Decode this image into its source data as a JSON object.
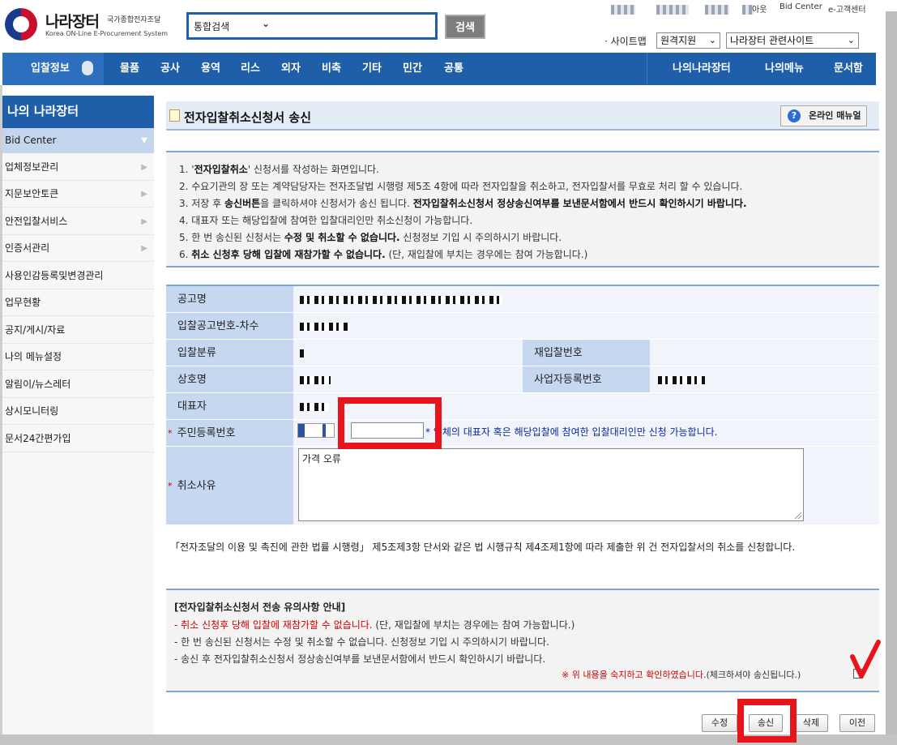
{
  "header": {
    "logo_title": "나라장터",
    "logo_sub_kr": "국가종합전자조달",
    "logo_sub_en": "Korea ON-Line E-Procurement System",
    "search_category": "통합검색",
    "search_button": "검색",
    "util_links": [
      "아웃",
      "Bid Center",
      "e-고객센터"
    ],
    "sitemap_label": "· 사이트맵",
    "remote_support": "원격지원",
    "related_sites": "나라장터 관련사이트"
  },
  "nav": {
    "first": "입찰정보",
    "items": [
      "물품",
      "공사",
      "용역",
      "리스",
      "외자",
      "비축",
      "기타",
      "민간",
      "공통"
    ],
    "right_items": [
      "나의나라장터",
      "나의메뉴",
      "문서함"
    ]
  },
  "sidebar": {
    "title": "나의 나라장터",
    "selected": "Bid Center",
    "items": [
      "업체정보관리",
      "지문보안토큰",
      "안전입찰서비스",
      "인증서관리",
      "사용인감등록및변경관리",
      "업무현황",
      "공지/게시/자료",
      "나의 메뉴설정",
      "알림이/뉴스레터",
      "상시모니터링",
      "문서24간편가입"
    ]
  },
  "page": {
    "title": "전자입찰취소신청서 송신",
    "manual_button": "온라인 매뉴얼",
    "notices": {
      "n1_pre": "1. '",
      "n1_bold": "전자입찰취소",
      "n1_post": "' 신청서를 작성하는 화면입니다.",
      "n2": "2. 수요기관의 장 또는 계약담당자는 전자조달법 시행령 제5조 4항에 따라 전자입찰을 취소하고, 전자입찰서를 무효로 처리 할 수 있습니다.",
      "n3_pre": "3. 저장 후 ",
      "n3_bold1": "송신버튼",
      "n3_mid": "을 클릭하셔야 신청서가 송신 됩니다. ",
      "n3_bold2": "전자입찰취소신청서 정상송신여부를 보낸문서함에서 반드시 확인하시기 바랍니다.",
      "n4": "4. 대표자 또는 해당입찰에 참여한 입찰대리인만 취소신청이 가능합니다.",
      "n5_pre": "5. 한 번 송신된 신청서는 ",
      "n5_bold": "수정 및 취소할 수 없습니다.",
      "n5_post": " 신청정보 기입 시 주의하시기 바랍니다.",
      "n6_pre": "6. ",
      "n6_bold": "취소 신청후 당해 입찰에 재참가할 수 없습니다.",
      "n6_post": " (단, 재입찰에 부치는 경우에는 참여 가능합니다.)"
    },
    "form": {
      "notice_name_label": "공고명",
      "bid_no_label": "입찰공고번호-차수",
      "bid_class_label": "입찰분류",
      "rebid_no_label": "재입찰번호",
      "company_label": "상호명",
      "biz_reg_label": "사업자등록번호",
      "ceo_label": "대표자",
      "rrn_label": "주민등록번호",
      "rrn_dash": "-",
      "rrn_note": "* 업체의 대표자 혹은 해당입찰에 참여한 입찰대리인만 신청 가능합니다.",
      "reason_label": "취소사유",
      "reason_value": "가격 오류"
    },
    "law_text": "「전자조달의 이용 및 촉진에 관한 법률 시행령」 제5조제3항 단서와 같은 법 시행규칙 제4조제1항에 따라 제출한 위 건 전자입찰서의 취소를 신청합니다.",
    "warning": {
      "title": "[전자입찰취소신청서 전송 유의사항 안내]",
      "l1_red": "- 취소 신청후 당해 입찰에 재참가할 수 없습니다.",
      "l1_post": " (단, 재입찰에 부치는 경우에는 참여 가능합니다.)",
      "l2": "- 한 번 송신된 신청서는 수정 및 취소할 수 없습니다. 신청정보 기입 시 주의하시기 바랍니다.",
      "l3": "- 송신 후 전자입찰취소신청서 정상송신여부를 보낸문서함에서 반드시 확인하시기 바랍니다.",
      "agree_red": "※ 위 내용을 숙지하고 확인하였습니다.",
      "agree_post": "(체크하셔야 송신됩니다.)"
    },
    "buttons": {
      "edit": "수정",
      "send": "송신",
      "delete": "삭제",
      "prev": "이전"
    }
  },
  "colors": {
    "nav_blue": "#1f5faa",
    "annotation_red": "#e8141b"
  }
}
